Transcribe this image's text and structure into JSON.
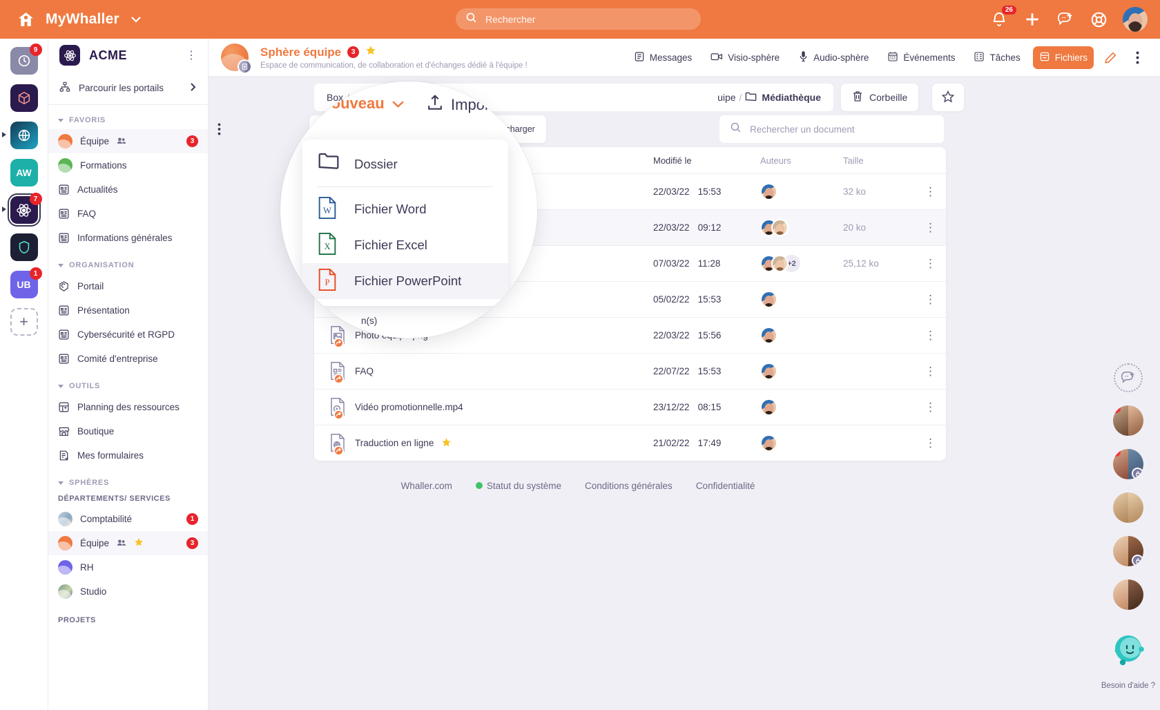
{
  "topbar": {
    "brand": "MyWhaller",
    "home_icon": "home-icon",
    "search_placeholder": "Rechercher",
    "notifications_count": "26",
    "icons": [
      "bell-icon",
      "plus-icon",
      "new-chat-icon",
      "lifebuoy-icon",
      "user-avatar"
    ]
  },
  "app_rail": [
    {
      "name": "clock-app",
      "badge": "9",
      "color": "#8b89a8",
      "label": ""
    },
    {
      "name": "cube-app",
      "badge": "",
      "color": "#2b1a4d",
      "label": ""
    },
    {
      "name": "globe-app",
      "badge": "",
      "color": "#14607a",
      "label": "",
      "expandable": true
    },
    {
      "name": "aw-app",
      "badge": "",
      "color": "#1cb0a8",
      "label": "AW"
    },
    {
      "name": "acme-app",
      "badge": "7",
      "color": "#2b1a4d",
      "label": "",
      "selected": true,
      "expandable": true
    },
    {
      "name": "shield-app",
      "badge": "",
      "color": "#1d1f35",
      "label": ""
    },
    {
      "name": "ub-app",
      "badge": "1",
      "color": "#6f63e8",
      "label": "UB"
    },
    {
      "name": "add-app",
      "badge": "",
      "color": "",
      "label": "+"
    }
  ],
  "sidebar": {
    "org_name": "ACME",
    "org_kebab": "⋮",
    "browse_portals": "Parcourir les portails",
    "sections": [
      {
        "title": "FAVORIS",
        "items": [
          {
            "label": "Équipe",
            "icon": "sphere-dot",
            "color": "#ef7940",
            "badge": "3",
            "members": true,
            "active": true
          },
          {
            "label": "Formations",
            "icon": "sphere-dot",
            "color": "#5ab552",
            "badge": "",
            "members": false
          },
          {
            "label": "Actualités",
            "icon": "page-icon",
            "badge": ""
          },
          {
            "label": "FAQ",
            "icon": "page-icon",
            "badge": ""
          },
          {
            "label": "Informations générales",
            "icon": "page-icon",
            "badge": ""
          }
        ]
      },
      {
        "title": "ORGANISATION",
        "items": [
          {
            "label": "Portail",
            "icon": "portal-icon",
            "badge": ""
          },
          {
            "label": "Présentation",
            "icon": "page-icon",
            "badge": ""
          },
          {
            "label": "Cybersécurité et RGPD",
            "icon": "page-icon",
            "badge": ""
          },
          {
            "label": "Comité d'entreprise",
            "icon": "page-icon",
            "badge": ""
          }
        ]
      },
      {
        "title": "OUTILS",
        "items": [
          {
            "label": "Planning des ressources",
            "icon": "planning-icon",
            "badge": ""
          },
          {
            "label": "Boutique",
            "icon": "shop-icon",
            "badge": ""
          },
          {
            "label": "Mes formulaires",
            "icon": "form-icon",
            "badge": ""
          }
        ]
      },
      {
        "title": "SPHÈRES",
        "group_label": "DÉPARTEMENTS/ SERVICES",
        "items": [
          {
            "label": "Comptabilité",
            "icon": "photo-dot",
            "color": "#9fb5c9",
            "badge": "1"
          },
          {
            "label": "Équipe",
            "icon": "sphere-dot",
            "color": "#ef7940",
            "badge": "3",
            "members": true,
            "star": true,
            "active": true
          },
          {
            "label": "RH",
            "icon": "sphere-dot",
            "color": "#6f63e8",
            "badge": ""
          },
          {
            "label": "Studio",
            "icon": "photo-dot",
            "color": "#7a9a8a",
            "badge": ""
          }
        ]
      }
    ],
    "bottom_group": "PROJETS"
  },
  "sphere_header": {
    "title": "Sphère équipe",
    "badge": "3",
    "starred": true,
    "description": "Espace de communication, de collaboration et d'échanges dédié à l'équipe !",
    "nav": [
      {
        "label": "Messages",
        "icon": "messages-icon",
        "selected": false
      },
      {
        "label": "Visio-sphère",
        "icon": "video-icon",
        "selected": false
      },
      {
        "label": "Audio-sphère",
        "icon": "mic-icon",
        "selected": false
      },
      {
        "label": "Événements",
        "icon": "calendar-icon",
        "selected": false
      },
      {
        "label": "Tâches",
        "icon": "tasks-icon",
        "selected": false
      },
      {
        "label": "Fichiers",
        "icon": "files-icon",
        "selected": true
      }
    ],
    "edit_icon": "pencil-icon",
    "more_icon": "kebab-icon"
  },
  "breadcrumb": {
    "root": "Box",
    "sep": "/",
    "mid_partial": "D",
    "mid_partial2": "uipe",
    "current": "Médiathèque",
    "folder_icon": "folder-icon"
  },
  "toolbar": {
    "new_label": "Nouveau",
    "new_caret": "⌄",
    "import_label": "Importer",
    "download_label": "Télécharger",
    "kebab": "⋮",
    "trash_label": "Corbeille",
    "star_icon": "star-outline-icon",
    "search_placeholder": "Rechercher un document"
  },
  "new_menu": {
    "items": [
      {
        "label": "Dossier",
        "icon": "folder-icon",
        "highlighted": false
      },
      {
        "label": "Fichier Word",
        "icon": "word-icon",
        "highlighted": false
      },
      {
        "label": "Fichier Excel",
        "icon": "excel-icon",
        "highlighted": false
      },
      {
        "label": "Fichier PowerPoint",
        "icon": "powerpoint-icon",
        "highlighted": true
      }
    ]
  },
  "file_table": {
    "columns": [
      "",
      "Modifié le",
      "Auteurs",
      "Taille",
      ""
    ],
    "rows": [
      {
        "name": "",
        "modified_date": "22/03/22",
        "modified_time": "15:53",
        "authors": 1,
        "extra_authors": "",
        "size": "32 ko",
        "alt": false,
        "icon": "file-icon",
        "star": false
      },
      {
        "name": "",
        "modified_date": "22/03/22",
        "modified_time": "09:12",
        "authors": 2,
        "extra_authors": "",
        "size": "20 ko",
        "alt": true,
        "icon": "file-icon",
        "star": false
      },
      {
        "name": "",
        "modified_date": "07/03/22",
        "modified_time": "11:28",
        "authors": 2,
        "extra_authors": "+2",
        "size": "25,12 ko",
        "alt": false,
        "icon": "file-icon",
        "star": false
      },
      {
        "name": "",
        "modified_date": "05/02/22",
        "modified_time": "15:53",
        "authors": 1,
        "extra_authors": "",
        "size": "",
        "alt": false,
        "icon": "file-icon",
        "star": false
      },
      {
        "name": "Photo équipe.png",
        "modified_date": "22/03/22",
        "modified_time": "15:56",
        "authors": 1,
        "extra_authors": "",
        "size": "",
        "alt": false,
        "icon": "image-icon",
        "star": false
      },
      {
        "name": "FAQ",
        "modified_date": "22/07/22",
        "modified_time": "15:53",
        "authors": 1,
        "extra_authors": "",
        "size": "",
        "alt": false,
        "icon": "page-file-icon",
        "star": false
      },
      {
        "name": "Vidéo promotionnelle.mp4",
        "modified_date": "23/12/22",
        "modified_time": "08:15",
        "authors": 1,
        "extra_authors": "",
        "size": "",
        "alt": false,
        "icon": "video-file-icon",
        "star": false
      },
      {
        "name": "Traduction en ligne",
        "modified_date": "21/02/22",
        "modified_time": "17:49",
        "authors": 1,
        "extra_authors": "",
        "size": "",
        "alt": false,
        "icon": "web-file-icon",
        "star": true
      }
    ],
    "partial_label": "n(s)"
  },
  "footer": {
    "links": [
      "Whaller.com",
      "Statut du système",
      "Conditions générales",
      "Confidentialité"
    ],
    "status_color": "#3fc46a"
  },
  "right_rail": {
    "new_chat_icon": "new-conversation-icon",
    "conversations": [
      {
        "name": "conversation-1",
        "unread": true,
        "locked": false
      },
      {
        "name": "conversation-2",
        "unread": true,
        "locked": true
      },
      {
        "name": "conversation-3",
        "unread": false,
        "locked": false
      },
      {
        "name": "conversation-4",
        "unread": false,
        "locked": true
      },
      {
        "name": "conversation-5",
        "unread": false,
        "locked": false
      }
    ],
    "help_label": "Besoin d'aide ?",
    "help_icon": "help-bot-icon"
  },
  "colors": {
    "brand_orange": "#ef7940",
    "dark_navy": "#3c3a55",
    "badge_red": "#e8242a",
    "page_bg": "#f0eff5",
    "star_yellow": "#f7c325"
  }
}
